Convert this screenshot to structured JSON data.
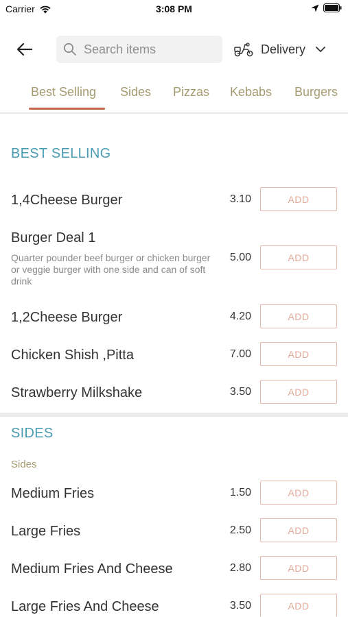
{
  "status_bar": {
    "carrier": "Carrier",
    "time": "3:08 PM"
  },
  "header": {
    "search_placeholder": "Search items",
    "delivery_label": "Delivery"
  },
  "tabs": [
    {
      "label": "Best Selling",
      "active": true
    },
    {
      "label": "Sides"
    },
    {
      "label": "Pizzas"
    },
    {
      "label": "Kebabs"
    },
    {
      "label": "Burgers"
    }
  ],
  "sections": {
    "best_selling": {
      "title": "BEST SELLING",
      "items": [
        {
          "name": "1,4Cheese Burger",
          "price": "3.10",
          "add_label": "ADD"
        },
        {
          "name": "Burger Deal 1",
          "description": "Quarter pounder beef burger or chicken burger or veggie burger with one side and can of soft drink",
          "price": "5.00",
          "add_label": "ADD"
        },
        {
          "name": "1,2Cheese Burger",
          "price": "4.20",
          "add_label": "ADD"
        },
        {
          "name": "Chicken Shish ,Pitta",
          "price": "7.00",
          "add_label": "ADD"
        },
        {
          "name": "Strawberry Milkshake",
          "price": "3.50",
          "add_label": "ADD"
        }
      ]
    },
    "sides": {
      "title": "SIDES",
      "subtitle": "Sides",
      "items": [
        {
          "name": "Medium Fries",
          "price": "1.50",
          "add_label": "ADD"
        },
        {
          "name": "Large Fries",
          "price": "2.50",
          "add_label": "ADD"
        },
        {
          "name": "Medium Fries And Cheese",
          "price": "2.80",
          "add_label": "ADD"
        },
        {
          "name": "Large Fries And Cheese",
          "price": "3.50",
          "add_label": "ADD"
        }
      ]
    }
  },
  "colors": {
    "section_title": "#4a9cb3",
    "tab_text": "#a59b70",
    "tab_underline": "#c1624a",
    "add_button_border": "#e7b8ac",
    "add_button_text": "#e3a898"
  },
  "icons": {
    "wifi": "wifi-icon",
    "location": "location-arrow-icon",
    "battery": "battery-icon",
    "back": "back-arrow-icon",
    "search": "search-icon",
    "delivery": "scooter-icon",
    "chevron": "chevron-down-icon"
  }
}
